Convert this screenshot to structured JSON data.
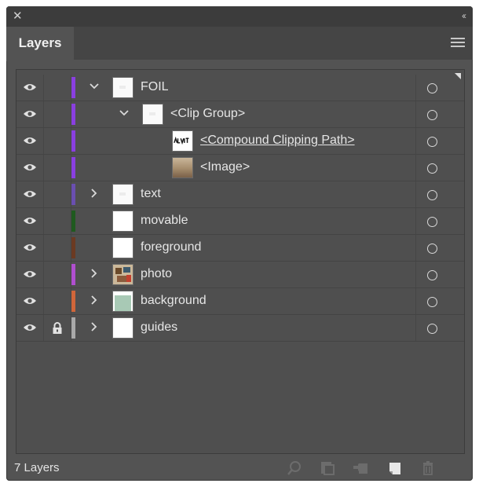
{
  "window": {
    "close_icon": "close-icon",
    "collapse_icon": "double-chevron-icon",
    "panel_menu_icon": "hamburger-menu-icon"
  },
  "tabs": [
    {
      "label": "Layers",
      "active": true
    }
  ],
  "layers": [
    {
      "name": "FOIL",
      "level": 0,
      "expanded": true,
      "has_children": true,
      "visible": true,
      "locked": false,
      "color": "#8a3fe0",
      "thumb": "light",
      "underlined": false
    },
    {
      "name": "<Clip Group>",
      "level": 1,
      "expanded": true,
      "has_children": true,
      "visible": true,
      "locked": false,
      "color": "#8a3fe0",
      "thumb": "light",
      "underlined": false
    },
    {
      "name": "<Compound Clipping Path>",
      "level": 2,
      "expanded": false,
      "has_children": false,
      "visible": true,
      "locked": false,
      "color": "#8a3fe0",
      "thumb": "text",
      "underlined": true
    },
    {
      "name": "<Image>",
      "level": 2,
      "expanded": false,
      "has_children": false,
      "visible": true,
      "locked": false,
      "color": "#8a3fe0",
      "thumb": "sepia",
      "underlined": false
    },
    {
      "name": "text",
      "level": 0,
      "expanded": false,
      "has_children": true,
      "visible": true,
      "locked": false,
      "color": "#6a4fb0",
      "thumb": "light",
      "underlined": false
    },
    {
      "name": "movable",
      "level": 0,
      "expanded": false,
      "has_children": false,
      "visible": true,
      "locked": false,
      "color": "#1f5a1f",
      "thumb": "white",
      "underlined": false
    },
    {
      "name": "foreground",
      "level": 0,
      "expanded": false,
      "has_children": false,
      "visible": true,
      "locked": false,
      "color": "#6b3a22",
      "thumb": "white",
      "underlined": false
    },
    {
      "name": "photo",
      "level": 0,
      "expanded": false,
      "has_children": true,
      "visible": true,
      "locked": false,
      "color": "#b04fcf",
      "thumb": "photo",
      "underlined": false
    },
    {
      "name": "background",
      "level": 0,
      "expanded": false,
      "has_children": true,
      "visible": true,
      "locked": false,
      "color": "#d0663a",
      "thumb": "green",
      "underlined": false
    },
    {
      "name": "guides",
      "level": 0,
      "expanded": false,
      "has_children": true,
      "visible": true,
      "locked": true,
      "color": "#a9a9a9",
      "thumb": "white",
      "underlined": false
    }
  ],
  "footer": {
    "count_label": "7 Layers",
    "icons": [
      "search-icon",
      "export-icon",
      "make-clipping-mask-icon",
      "new-sublayer-icon",
      "new-layer-icon",
      "delete-icon"
    ]
  }
}
